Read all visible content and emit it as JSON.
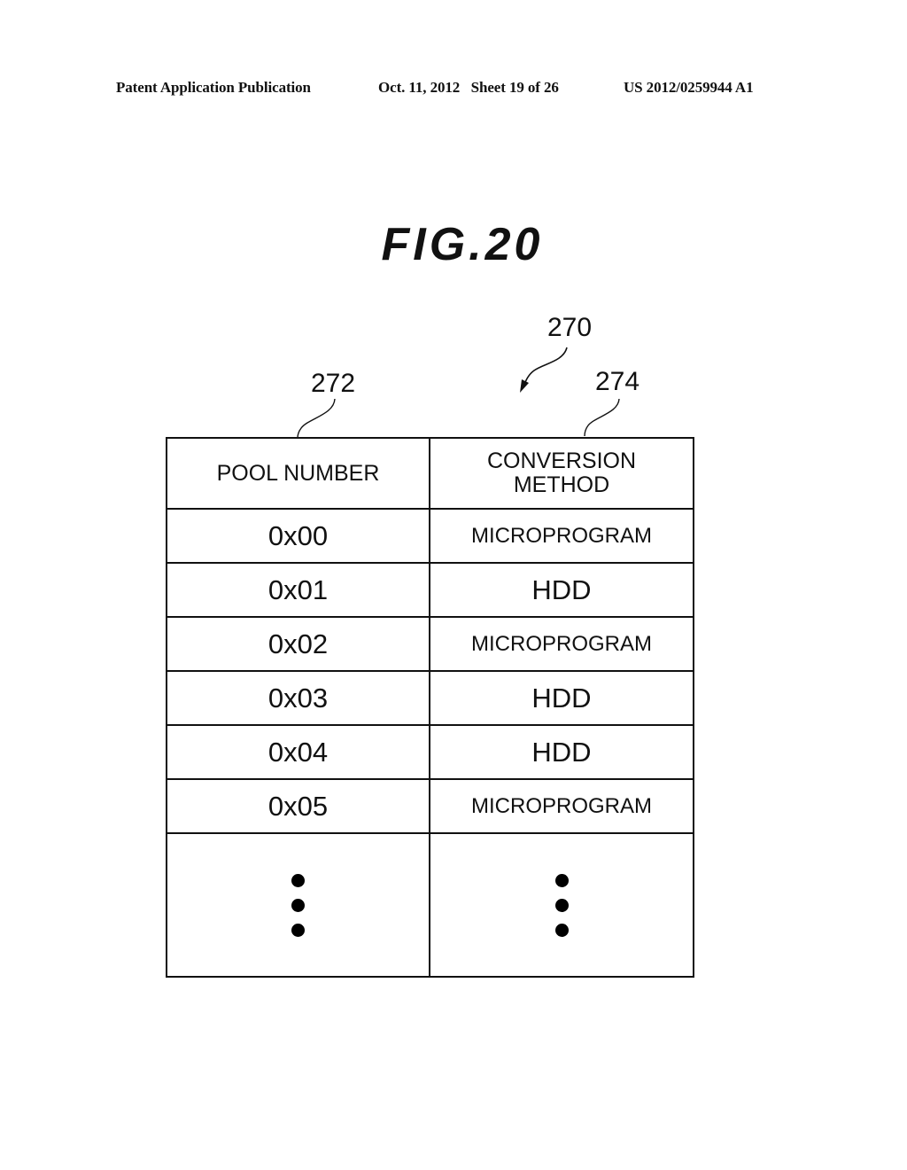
{
  "header": {
    "publication": "Patent Application Publication",
    "date_sheet": "Oct. 11, 2012   Sheet 19 of 26",
    "patent_number": "US 2012/0259944 A1"
  },
  "figure": {
    "title": "FIG.20",
    "reference_numerals": {
      "table": "270",
      "pool_number_column": "272",
      "conversion_method_column": "274"
    }
  },
  "table": {
    "columns": [
      "POOL NUMBER",
      "CONVERSION METHOD"
    ],
    "column_lines": {
      "pool_number": [
        "POOL NUMBER"
      ],
      "conversion_method": [
        "CONVERSION",
        "METHOD"
      ]
    },
    "rows": [
      {
        "pool_number": "0x00",
        "conversion_method": "MICROPROGRAM"
      },
      {
        "pool_number": "0x01",
        "conversion_method": "HDD"
      },
      {
        "pool_number": "0x02",
        "conversion_method": "MICROPROGRAM"
      },
      {
        "pool_number": "0x03",
        "conversion_method": "HDD"
      },
      {
        "pool_number": "0x04",
        "conversion_method": "HDD"
      },
      {
        "pool_number": "0x05",
        "conversion_method": "MICROPROGRAM"
      }
    ],
    "continuation": "vertical-ellipsis"
  }
}
